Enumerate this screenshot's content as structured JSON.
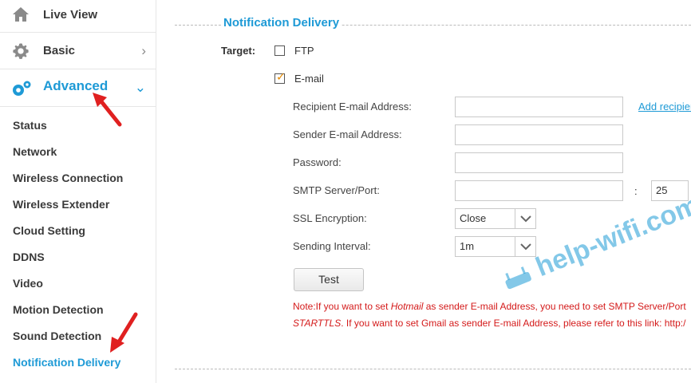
{
  "sidebar": {
    "live_view": "Live View",
    "basic": "Basic",
    "advanced": "Advanced",
    "submenu": [
      "Status",
      "Network",
      "Wireless Connection",
      "Wireless Extender",
      "Cloud Setting",
      "DDNS",
      "Video",
      "Motion Detection",
      "Sound Detection",
      "Notification Delivery"
    ],
    "active_item": "Notification Delivery",
    "icons": [
      "home-icon",
      "gear-icon",
      "advanced-gears-icon"
    ]
  },
  "main": {
    "title": "Notification Delivery",
    "target_label": "Target:",
    "ftp_label": "FTP",
    "ftp_checked": false,
    "email_label": "E-mail",
    "email_checked": true,
    "recipient_label": "Recipient E-mail Address:",
    "add_recipient_link": "Add recipien",
    "sender_label": "Sender E-mail Address:",
    "password_label": "Password:",
    "smtp_label": "SMTP Server/Port:",
    "port_separator": ":",
    "smtp_port": "25",
    "ssl_label": "SSL Encryption:",
    "ssl_value": "Close",
    "interval_label": "Sending Interval:",
    "interval_value": "1m",
    "test_button": "Test",
    "note_line1_a": "Note:If you want to set ",
    "note_line1_b": "Hotmail",
    "note_line1_c": " as sender E-mail Address, you need to set SMTP Server/Port",
    "note_line2_a": "STARTTLS",
    "note_line2_b": ". If you want to set Gmail as sender E-mail Address, please refer to this link: http:/",
    "watermark": "help-wifi.com"
  },
  "colors": {
    "accent": "#1e9ad6",
    "note": "#d41a1a",
    "arrow": "#e02020",
    "checkmark": "#e58a00"
  }
}
